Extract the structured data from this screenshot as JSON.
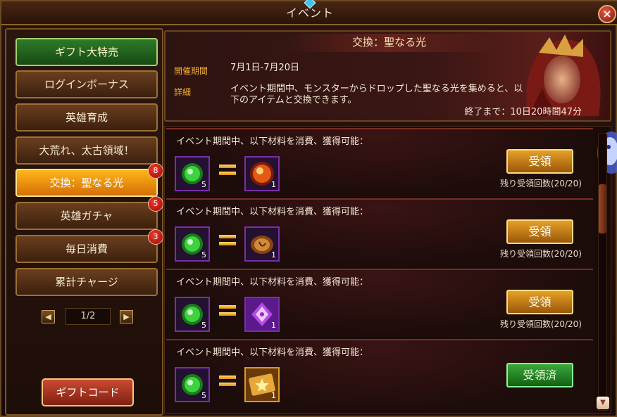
{
  "window": {
    "title": "イベント",
    "close_icon": "×"
  },
  "sidebar": {
    "items": [
      {
        "label": "ギフト大特売",
        "state": "green"
      },
      {
        "label": "ログインボーナス",
        "state": "normal"
      },
      {
        "label": "英雄育成",
        "state": "normal"
      },
      {
        "label": "大荒れ、太古領域！",
        "state": "normal"
      },
      {
        "label": "交換：聖なる光",
        "state": "active",
        "badge": "8"
      },
      {
        "label": "英雄ガチャ",
        "state": "normal",
        "badge": "5"
      },
      {
        "label": "毎日消費",
        "state": "normal",
        "badge": "3"
      },
      {
        "label": "累計チャージ",
        "state": "normal"
      }
    ],
    "pager": {
      "prev_icon": "◀",
      "page": "1/2",
      "next_icon": "▶"
    },
    "gift_code_label": "ギフトコード"
  },
  "event": {
    "title": "交換：聖なる光",
    "period_label": "開催期間",
    "period_value": "7月1日-7月20日",
    "detail_label": "詳細",
    "detail_line1": "イベント期間中、モンスターからドロップした聖なる光を集めると、以",
    "detail_line2": "下のアイテムと交換できます。",
    "remaining": "終了まで：10日20時間47分"
  },
  "exchanges": [
    {
      "heading": "イベント期間中、以下材料を消費、獲得可能：",
      "cost_icon": "holy-light-orb-icon",
      "cost_qty": "5",
      "reward_icon": "fire-orb-icon",
      "reward_qty": "1",
      "button": "受領",
      "claimed": false,
      "limit": "残り受領回数(20/20)"
    },
    {
      "heading": "イベント期間中、以下材料を消費、獲得可能：",
      "cost_icon": "holy-light-orb-icon",
      "cost_qty": "5",
      "reward_icon": "bronze-emblem-icon",
      "reward_qty": "1",
      "button": "受領",
      "claimed": false,
      "limit": "残り受領回数(20/20)"
    },
    {
      "heading": "イベント期間中、以下材料を消費、獲得可能：",
      "cost_icon": "holy-light-orb-icon",
      "cost_qty": "5",
      "reward_icon": "purple-crest-icon",
      "reward_qty": "1",
      "button": "受領",
      "claimed": false,
      "limit": "残り受領回数(20/20)"
    },
    {
      "heading": "イベント期間中、以下材料を消費、獲得可能：",
      "cost_icon": "holy-light-orb-icon",
      "cost_qty": "5",
      "reward_icon": "gold-star-scroll-icon",
      "reward_qty": "1",
      "button": "受領済",
      "claimed": true,
      "limit": ""
    }
  ],
  "colors": {
    "accent_orange": "#ffb618",
    "label_gold": "#f2ad36",
    "claimed_green": "#3aa83a"
  }
}
